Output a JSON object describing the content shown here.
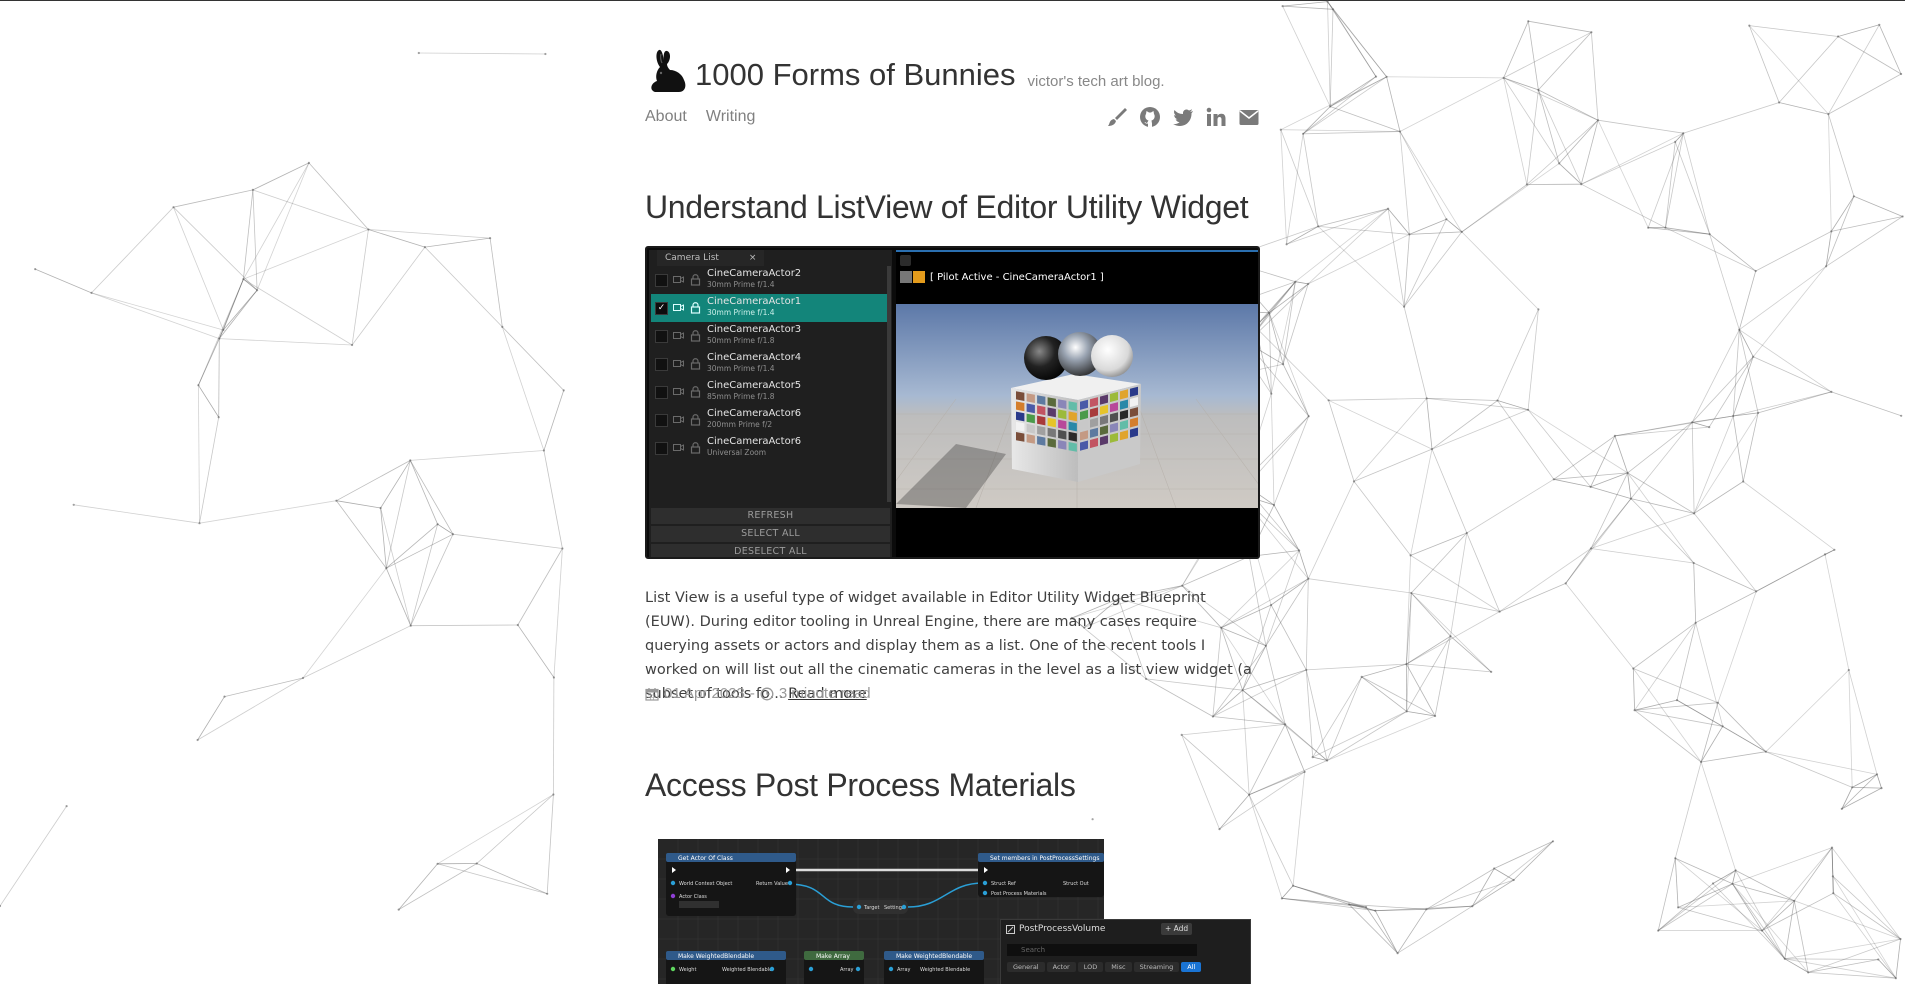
{
  "site": {
    "title": "1000 Forms of Bunnies",
    "tagline": "victor's tech art blog."
  },
  "nav": {
    "links": [
      "About",
      "Writing"
    ],
    "social_icons": [
      "brush-icon",
      "github-icon",
      "twitter-icon",
      "linkedin-icon",
      "envelope-icon"
    ]
  },
  "posts": [
    {
      "title": "Understand ListView of Editor Utility Widget",
      "excerpt": "List View is a useful type of widget available in Editor Utility Widget Blueprint (EUW). During editor tooling in Unreal Engine, there are many cases require querying assets or actors and display them as a list. One of the recent tools I worked on will list out all the cinematic cameras in the level as a list view widget (a subset of tools fo...",
      "read_more": "Read more",
      "date": "01 Apr 2023",
      "separator": "-",
      "read_time": "3 minute read",
      "image": {
        "tab_label": "Camera List",
        "tab_close": "×",
        "cameras": [
          {
            "name": "CineCameraActor2",
            "lens": "30mm Prime f/1.4",
            "checked": false,
            "active": false
          },
          {
            "name": "CineCameraActor1",
            "lens": "30mm Prime f/1.4",
            "checked": true,
            "active": true
          },
          {
            "name": "CineCameraActor3",
            "lens": "50mm Prime f/1.8",
            "checked": false,
            "active": false
          },
          {
            "name": "CineCameraActor4",
            "lens": "30mm Prime f/1.4",
            "checked": false,
            "active": false
          },
          {
            "name": "CineCameraActor5",
            "lens": "85mm Prime f/1.8",
            "checked": false,
            "active": false
          },
          {
            "name": "CineCameraActor6",
            "lens": "200mm Prime f/2",
            "checked": false,
            "active": false
          },
          {
            "name": "CineCameraActor6",
            "lens": "Universal Zoom",
            "checked": false,
            "active": false
          }
        ],
        "buttons": [
          "REFRESH",
          "SELECT ALL",
          "DESELECT ALL"
        ],
        "viewport_label": "[ Pilot Active - CineCameraActor1 ]",
        "check_mark": "✓"
      }
    },
    {
      "title": "Access Post Process Materials",
      "image": {
        "nodes": [
          "Get Actor Of Class",
          "World Context Object",
          "Actor Class",
          "Return Value",
          "Target",
          "Settings",
          "Set members in PostProcessSettings",
          "Struct Ref",
          "Struct Out",
          "Post Process Materials",
          "Make WeightedBlendable",
          "Weight",
          "Object",
          "Weighted Blendable",
          "Make Array",
          "Array"
        ],
        "panel_title": "PostProcessVolume",
        "panel_add": "+ Add",
        "search_placeholder": "Search",
        "tabs": [
          "General",
          "Actor",
          "LOD",
          "Misc",
          "Streaming",
          "All"
        ],
        "active_tab": "All"
      }
    }
  ],
  "colors": {
    "accent_teal": "#13857a",
    "ue_orange": "#e39b1c",
    "ue_blue": "#1a74d4",
    "title_text": "#333333",
    "meta_text": "#999999"
  }
}
